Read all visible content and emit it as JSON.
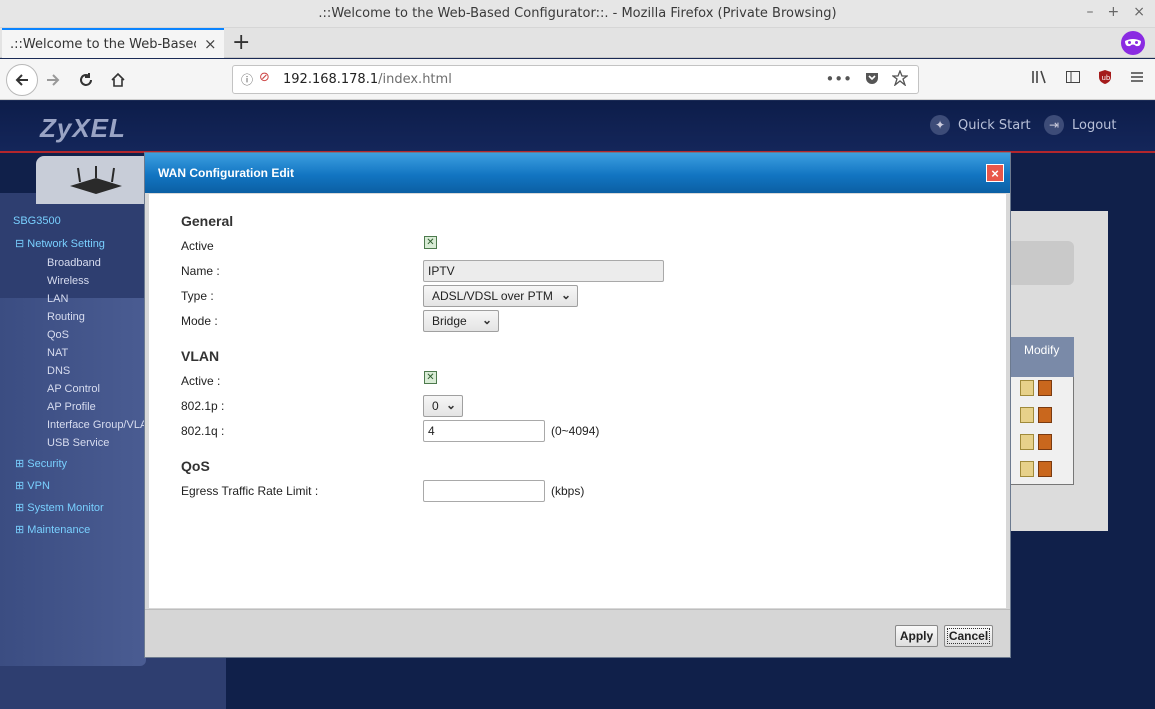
{
  "window": {
    "title": ".::Welcome to the Web-Based Configurator::. - Mozilla Firefox (Private Browsing)",
    "controls": [
      "–",
      "+",
      "×"
    ]
  },
  "tabs": [
    {
      "title": ".::Welcome to the Web-Based Configurator::.",
      "close": "×"
    }
  ],
  "toolbar": {
    "new_tab": "+",
    "url_host": "192.168.178.1",
    "url_path": "/index.html",
    "url_actions": [
      "•••",
      "pocket-icon",
      "star-icon"
    ],
    "right_icons": [
      "library-icon",
      "sidebar-icon",
      "ublock-icon",
      "menu-icon"
    ]
  },
  "header": {
    "logo": "ZyXEL",
    "quick_start": "Quick Start",
    "logout": "Logout"
  },
  "sidebar": {
    "device": "SBG3500",
    "network_setting": "Network Setting",
    "items": [
      "Broadband",
      "Wireless",
      "LAN",
      "Routing",
      "QoS",
      "NAT",
      "DNS",
      "AP Control",
      "AP Profile",
      "Interface Group/VLAN",
      "USB Service"
    ],
    "groups": [
      "Security",
      "VPN",
      "System Monitor",
      "Maintenance"
    ]
  },
  "background_table": {
    "modify_header": "Modify",
    "rows": 4
  },
  "modal": {
    "title": "WAN Configuration Edit",
    "close": "×",
    "general": {
      "heading": "General",
      "active_label": "Active",
      "active_checked": true,
      "name_label": "Name :",
      "name_value": "IPTV",
      "type_label": "Type :",
      "type_value": "ADSL/VDSL over PTM",
      "mode_label": "Mode :",
      "mode_value": "Bridge"
    },
    "vlan": {
      "heading": "VLAN",
      "active_label": "Active :",
      "active_checked": true,
      "p_label": "802.1p :",
      "p_value": "0",
      "q_label": "802.1q :",
      "q_value": "4",
      "q_hint": "(0~4094)"
    },
    "qos": {
      "heading": "QoS",
      "egress_label": "Egress Traffic Rate Limit :",
      "egress_value": "",
      "egress_hint": "(kbps)"
    },
    "apply": "Apply",
    "cancel": "Cancel"
  },
  "colors": {
    "modal_header": "#1275c2",
    "page_bg": "#10204a",
    "accent_red": "#b3262c"
  }
}
